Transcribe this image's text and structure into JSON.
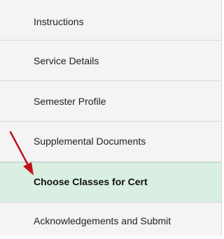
{
  "nav": {
    "items": [
      {
        "label": "Instructions",
        "active": false
      },
      {
        "label": "Service Details",
        "active": false
      },
      {
        "label": "Semester Profile",
        "active": false
      },
      {
        "label": "Supplemental Documents",
        "active": false
      },
      {
        "label": "Choose Classes for Cert",
        "active": true
      },
      {
        "label": "Acknowledgements and Submit",
        "active": false
      }
    ]
  },
  "colors": {
    "active_background": "#d9efe2",
    "arrow": "#c1121a"
  },
  "annotation": {
    "icon": "red-arrow-icon"
  }
}
